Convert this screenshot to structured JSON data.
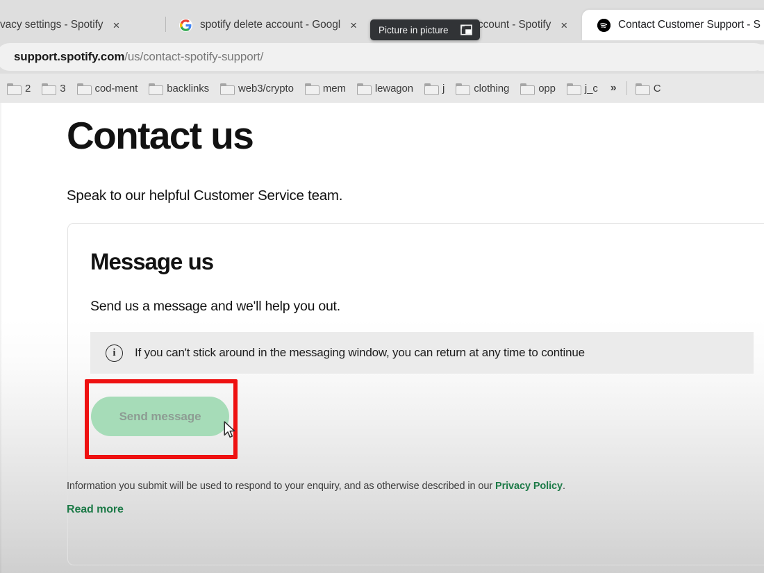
{
  "browser": {
    "tabs": [
      {
        "title": "vacy settings - Spotify",
        "favicon": "none",
        "active": false,
        "close_label": "×"
      },
      {
        "title": "spotify delete account - Googl",
        "favicon": "google-icon",
        "active": false,
        "close_label": "×"
      },
      {
        "title": "ccount - Spotify",
        "favicon": "none",
        "active": false,
        "close_label": "×"
      },
      {
        "title": "Contact Customer Support - S",
        "favicon": "spotify-icon",
        "active": true,
        "close_label": ""
      }
    ],
    "pip_tooltip": {
      "label": "Picture in picture",
      "icon": "picture-in-picture-icon"
    },
    "omnibox": {
      "domain": "support.spotify.com",
      "path": "/us/contact-spotify-support/"
    },
    "bookmarks": [
      {
        "label": "2",
        "icon": "folder-icon"
      },
      {
        "label": "3",
        "icon": "folder-icon"
      },
      {
        "label": "cod-ment",
        "icon": "folder-icon"
      },
      {
        "label": "backlinks",
        "icon": "folder-icon"
      },
      {
        "label": "web3/crypto",
        "icon": "folder-icon"
      },
      {
        "label": "mem",
        "icon": "folder-icon"
      },
      {
        "label": "lewagon",
        "icon": "folder-icon"
      },
      {
        "label": "j",
        "icon": "folder-icon"
      },
      {
        "label": "clothing",
        "icon": "folder-icon"
      },
      {
        "label": "opp",
        "icon": "folder-icon"
      },
      {
        "label": "j_c",
        "icon": "folder-icon"
      }
    ],
    "bookmarks_overflow": "»",
    "bookmarks_trailing": {
      "label": "C",
      "icon": "folder-icon"
    }
  },
  "page": {
    "title": "Contact us",
    "lede": "Speak to our helpful Customer Service team.",
    "card": {
      "heading": "Message us",
      "subheading": "Send us a message and we'll help you out.",
      "notice": {
        "icon": "info-icon",
        "glyph": "i",
        "text": "If you can't stick around in the messaging window, you can return at any time to continue"
      },
      "send_button": {
        "label": "Send message",
        "state": "disabled"
      }
    },
    "footer": {
      "text_before": "Information you submit will be used to respond to your enquiry, and as otherwise described in our ",
      "link": "Privacy Policy",
      "text_after": ".",
      "read_more": "Read more"
    }
  },
  "annotation": {
    "highlight_color": "#ee1111",
    "target": "send-message-button"
  },
  "colors": {
    "brand_green": "#1c7a47",
    "button_green": "#a6dcb8",
    "button_text": "#8d9c93",
    "notice_bg": "#ebebeb",
    "chrome_bg": "#dedede"
  }
}
